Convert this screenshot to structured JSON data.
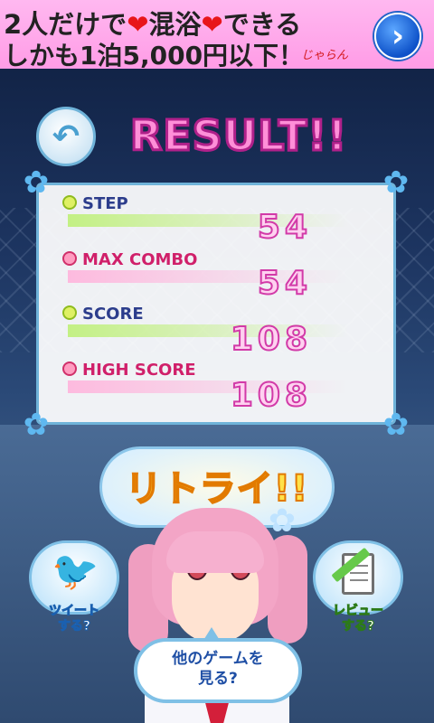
{
  "ad": {
    "line1_a": "2人だけで",
    "heart": "❤",
    "line1_b": "混浴",
    "line1_c": "できる",
    "line2": "しかも1泊5,000円以下！",
    "logo": "じゃらん",
    "next_icon": "chevron-right-icon"
  },
  "title": "RESULT!!",
  "stats": {
    "step": {
      "label": "STEP",
      "value": "54"
    },
    "max_combo": {
      "label": "MAX COMBO",
      "value": "54"
    },
    "score": {
      "label": "SCORE",
      "value": "108"
    },
    "high_score": {
      "label": "HIGH SCORE",
      "value": "108"
    }
  },
  "retry": "リトライ!!",
  "tweet": {
    "line1": "ツイート",
    "line2": "する?"
  },
  "review": {
    "line1": "レビュー",
    "line2": "する?"
  },
  "other_games": {
    "line1": "他のゲームを",
    "line2": "見る?"
  },
  "colors": {
    "title_pink": "#ff8fd8",
    "accent_blue": "#6fb3d9",
    "retry_yellow": "#ffe24a"
  }
}
